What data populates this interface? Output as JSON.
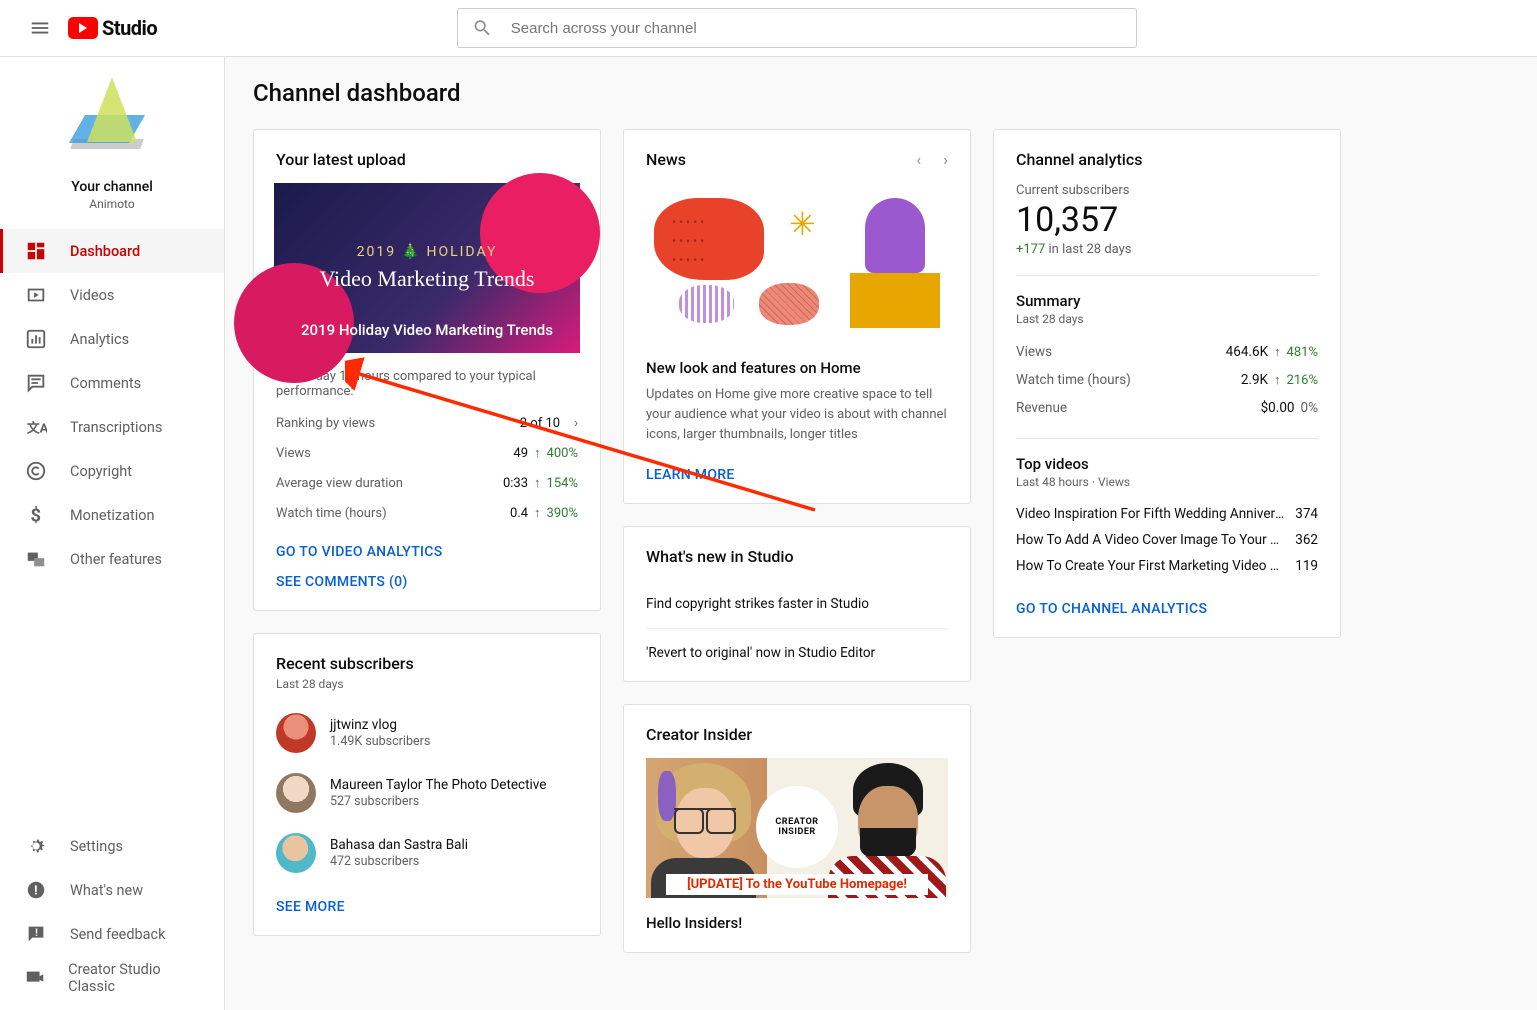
{
  "header": {
    "logo_text": "Studio",
    "search_placeholder": "Search across your channel"
  },
  "sidebar": {
    "your_channel_label": "Your channel",
    "channel_name": "Animoto",
    "nav": [
      {
        "label": "Dashboard",
        "icon": "dashboard"
      },
      {
        "label": "Videos",
        "icon": "videos"
      },
      {
        "label": "Analytics",
        "icon": "analytics"
      },
      {
        "label": "Comments",
        "icon": "comments"
      },
      {
        "label": "Transcriptions",
        "icon": "transcriptions"
      },
      {
        "label": "Copyright",
        "icon": "copyright"
      },
      {
        "label": "Monetization",
        "icon": "monetization"
      },
      {
        "label": "Other features",
        "icon": "other"
      }
    ],
    "footer": [
      {
        "label": "Settings",
        "icon": "settings"
      },
      {
        "label": "What's new",
        "icon": "whatsnew"
      },
      {
        "label": "Send feedback",
        "icon": "feedback"
      },
      {
        "label": "Creator Studio Classic",
        "icon": "classic"
      }
    ]
  },
  "page": {
    "title": "Channel dashboard"
  },
  "latest_upload": {
    "card_title": "Your latest upload",
    "thumb_year": "2019 🎄 HOLIDAY",
    "thumb_main": "Video Marketing Trends",
    "video_title": "2019 Holiday Video Marketing Trends",
    "comparison_text": "First 1 day 19 hours compared to your typical performance:",
    "ranking_label": "Ranking by views",
    "ranking_value": "2 of 10",
    "views_label": "Views",
    "views_value": "49",
    "views_delta": "400%",
    "avd_label": "Average view duration",
    "avd_value": "0:33",
    "avd_delta": "154%",
    "watch_label": "Watch time (hours)",
    "watch_value": "0.4",
    "watch_delta": "390%",
    "analytics_link": "GO TO VIDEO ANALYTICS",
    "comments_link": "SEE COMMENTS (0)"
  },
  "recent_subs": {
    "card_title": "Recent subscribers",
    "period": "Last 28 days",
    "list": [
      {
        "name": "jjtwinz vlog",
        "count": "1.49K subscribers"
      },
      {
        "name": "Maureen Taylor The Photo Detective",
        "count": "527 subscribers"
      },
      {
        "name": "Bahasa dan Sastra Bali",
        "count": "472 subscribers"
      }
    ],
    "see_more": "SEE MORE"
  },
  "news": {
    "card_title": "News",
    "title": "New look and features on Home",
    "body": "Updates on Home give more creative space to tell your audience what your video is about with channel icons, larger thumbnails, longer titles",
    "learn_more": "LEARN MORE"
  },
  "whats_new_studio": {
    "card_title": "What's new in Studio",
    "items": [
      "Find copyright strikes faster in Studio",
      "'Revert to original' now in Studio Editor"
    ]
  },
  "creator_insider": {
    "card_title": "Creator Insider",
    "badge": "CREATOR INSIDER",
    "banner": "[UPDATE] To the YouTube Homepage!",
    "title": "Hello Insiders!"
  },
  "analytics": {
    "card_title": "Channel analytics",
    "current_label": "Current subscribers",
    "current_value": "10,357",
    "delta_value": "+177",
    "delta_period": " in last 28 days",
    "summary_title": "Summary",
    "summary_period": "Last 28 days",
    "metrics": [
      {
        "label": "Views",
        "value": "464.6K",
        "delta": "481%"
      },
      {
        "label": "Watch time (hours)",
        "value": "2.9K",
        "delta": "216%"
      },
      {
        "label": "Revenue",
        "value": "$0.00",
        "delta": "0%",
        "neutral": true
      }
    ],
    "top_title": "Top videos",
    "top_period": "Last 48 hours · Views",
    "top_videos": [
      {
        "title": "Video Inspiration For Fifth Wedding Anniversary",
        "views": "374"
      },
      {
        "title": "How To Add A Video Cover Image To Your Facebook …",
        "views": "362"
      },
      {
        "title": "How To Create Your First Marketing Video With Anim…",
        "views": "119"
      }
    ],
    "link": "GO TO CHANNEL ANALYTICS"
  }
}
